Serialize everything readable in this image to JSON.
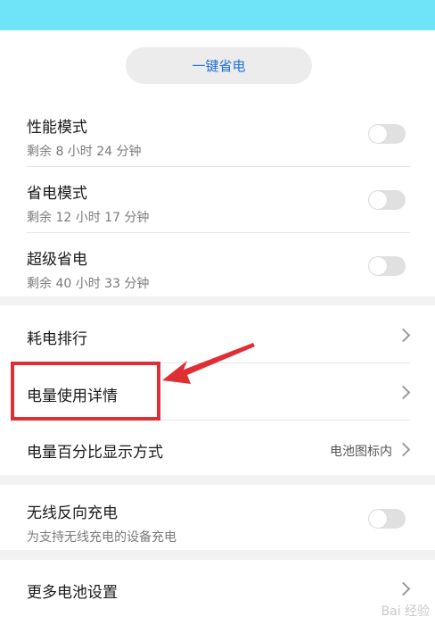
{
  "header": {
    "color": "#6fe3f7"
  },
  "one_key_save_label": "一键省电",
  "modes": [
    {
      "title": "性能模式",
      "subtitle": "剩余 8 小时 24 分钟",
      "enabled": false
    },
    {
      "title": "省电模式",
      "subtitle": "剩余 12 小时 17 分钟",
      "enabled": false
    },
    {
      "title": "超级省电",
      "subtitle": "剩余 40 小时 33 分钟",
      "enabled": false
    }
  ],
  "menu": [
    {
      "label": "耗电排行"
    },
    {
      "label": "电量使用详情"
    },
    {
      "label": "电量百分比显示方式",
      "value": "电池图标内"
    }
  ],
  "wireless_reverse": {
    "title": "无线反向充电",
    "subtitle": "为支持无线充电的设备充电",
    "enabled": false
  },
  "more_settings": {
    "label": "更多电池设置"
  },
  "annotation": {
    "highlight_color": "#e02f34"
  },
  "watermark": "Bai 经验"
}
